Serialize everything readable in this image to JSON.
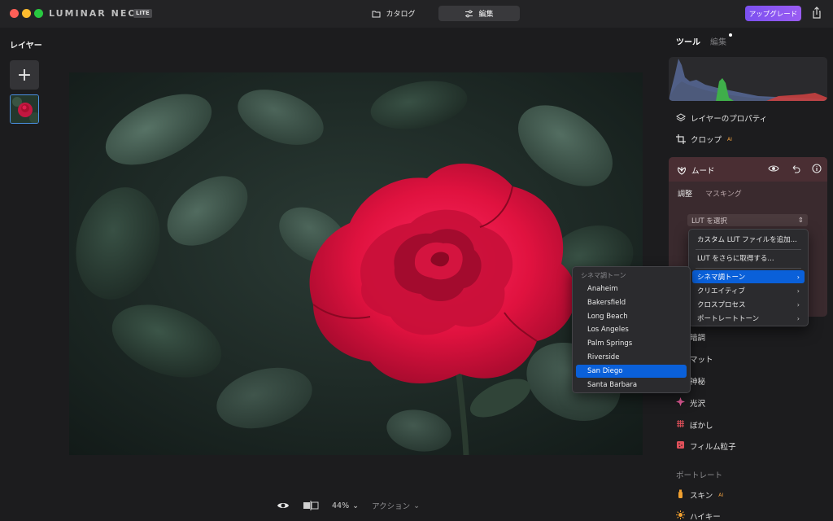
{
  "app": {
    "logo": "LUMINAR NEO",
    "badge": "LITE"
  },
  "topnav": {
    "catalog_label": "カタログ",
    "edit_label": "編集",
    "upgrade_label": "アップグレード"
  },
  "left_panel": {
    "title": "レイヤー",
    "add_label": "+"
  },
  "bottom_bar": {
    "zoom": "44%",
    "action_label": "アクション"
  },
  "right_panel": {
    "tab_tools": "ツール",
    "tab_edit": "編集",
    "layer_properties": "レイヤーのプロパティ",
    "crop": "クロップ",
    "ai_tag": "AI",
    "mood": {
      "title": "ムード",
      "tab_adjust": "調整",
      "tab_masking": "マスキング",
      "lut_placeholder": "LUT を選択"
    },
    "tools": [
      {
        "label": "暗調",
        "icon": "dark-tone-icon",
        "color": "#c0c0c0"
      },
      {
        "label": "マット",
        "icon": "matte-icon",
        "color": "#c0c0c0"
      },
      {
        "label": "神秘",
        "icon": "mystic-icon",
        "color": "#c0c0c0"
      },
      {
        "label": "光沢",
        "icon": "glow-icon",
        "color": "#e85c9a"
      },
      {
        "label": "ぼかし",
        "icon": "blur-icon",
        "color": "#e0505a"
      },
      {
        "label": "フィルム粒子",
        "icon": "film-grain-icon",
        "color": "#e0505a"
      }
    ],
    "section_portrait": "ポートレート",
    "portrait_tools": [
      {
        "label": "スキン",
        "icon": "skin-icon",
        "color": "#f0a030"
      },
      {
        "label": "ハイキー",
        "icon": "high-key-icon",
        "color": "#f0a030"
      }
    ]
  },
  "lut_menu": {
    "items": [
      {
        "label": "カスタム LUT ファイルを追加..."
      },
      {
        "label": "LUT をさらに取得する..."
      },
      {
        "label": "シネマ調トーン",
        "submenu": true,
        "selected": true
      },
      {
        "label": "クリエイティブ",
        "submenu": true
      },
      {
        "label": "クロスプロセス",
        "submenu": true
      },
      {
        "label": "ポートレートトーン",
        "submenu": true
      }
    ]
  },
  "cinema_submenu": {
    "header": "シネマ調トーン",
    "items": [
      "Anaheim",
      "Bakersfield",
      "Long Beach",
      "Los Angeles",
      "Palm Springs",
      "Riverside",
      "San Diego",
      "Santa Barbara"
    ],
    "selected": "San Diego"
  },
  "colors": {
    "accent_blue": "#0a60d9",
    "upgrade_purple": "#8a56f1",
    "mood_panel": "#4a2e33"
  }
}
